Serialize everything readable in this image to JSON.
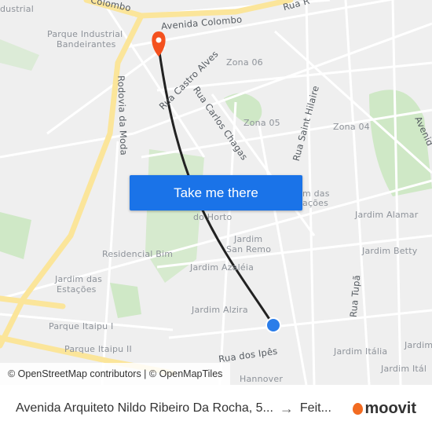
{
  "map": {
    "labels_roads": [
      "Avenida Colombo",
      "Colombo",
      "Rua R",
      "Rua Castro Alves",
      "Rua Carlos Chagas",
      "Rua Saint Hilaire",
      "Rodovia da Moda",
      "Rua dos Ipês",
      "Rua Tupã",
      "Avenid"
    ],
    "labels_areas": [
      "Parque Industrial",
      "Bandeirantes",
      "Zona 06",
      "Zona 05",
      "Zona 04",
      "dustrial",
      "Jardim das",
      "Estações",
      "Residencial Bim",
      "Jardim",
      "San Remo",
      "Jardim Azaléia",
      "Jardim Alzira",
      "Parque Itaipu I",
      "Parque Itaipu II",
      "do Horto",
      "Jardim Alamar",
      "Jardim Betty",
      "Jardim Itália",
      "Jardim",
      "Jardim Itál",
      "m das",
      "ações",
      "Hannover"
    ],
    "colors": {
      "route": "#222222",
      "destination_pin": "#f4511e",
      "origin_dot": "#1a73e8",
      "highway": "#fbe59a",
      "park": "#cfe8c6"
    }
  },
  "cta": {
    "label": "Take me there"
  },
  "attribution": "© OpenStreetMap contributors | © OpenMapTiles",
  "footer": {
    "origin": "Avenida Arquiteto Nildo Ribeiro Da Rocha, 5...",
    "arrow": "→",
    "destination": "Feit...",
    "brand": "moovit"
  }
}
